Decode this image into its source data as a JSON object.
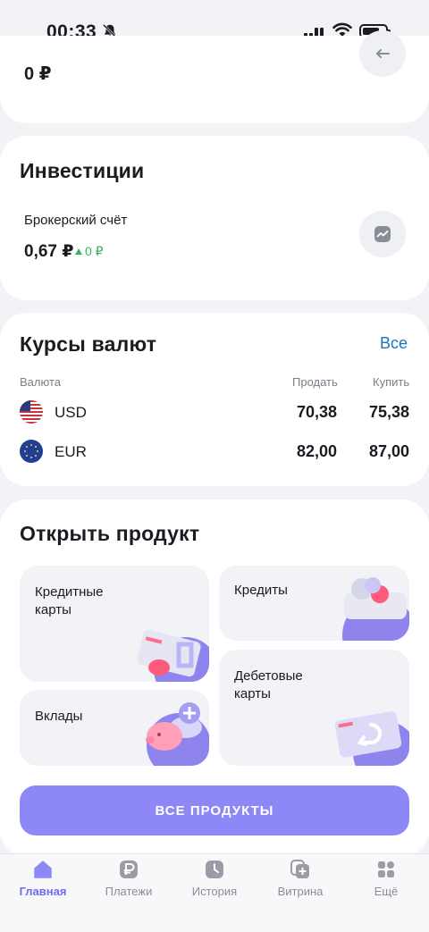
{
  "status": {
    "time": "00:33"
  },
  "top": {
    "amount": "0 ₽"
  },
  "investments": {
    "title": "Инвестиции",
    "account_name": "Брокерский счёт",
    "amount": "0,67 ₽",
    "change": "0 ₽"
  },
  "rates": {
    "title": "Курсы валют",
    "all_link": "Все",
    "headers": {
      "currency": "Валюта",
      "sell": "Продать",
      "buy": "Купить"
    },
    "rows": [
      {
        "code": "USD",
        "sell": "70,38",
        "buy": "75,38"
      },
      {
        "code": "EUR",
        "sell": "82,00",
        "buy": "87,00"
      }
    ]
  },
  "products": {
    "title": "Открыть продукт",
    "tiles": {
      "credit_cards": "Кредитные\nкарты",
      "credits": "Кредиты",
      "deposits": "Вклады",
      "debit_cards": "Дебетовые\nкарты"
    },
    "all_button": "ВСЕ ПРОДУКТЫ"
  },
  "tabbar": [
    {
      "label": "Главная",
      "icon": "home-icon",
      "active": true
    },
    {
      "label": "Платежи",
      "icon": "ruble-icon",
      "active": false
    },
    {
      "label": "История",
      "icon": "clock-icon",
      "active": false
    },
    {
      "label": "Витрина",
      "icon": "showcase-icon",
      "active": false
    },
    {
      "label": "Ещё",
      "icon": "grid-icon",
      "active": false
    }
  ],
  "colors": {
    "accent": "#8d88f6",
    "link": "#1f73b7",
    "positive": "#3ab35c",
    "active_tab": "#6f6af0"
  }
}
